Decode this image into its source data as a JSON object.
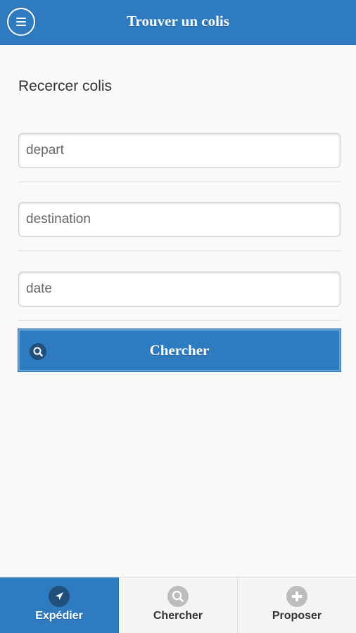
{
  "header": {
    "title": "Trouver un colis",
    "menu_icon": "menu-icon"
  },
  "main": {
    "section_label": "Recercer colis",
    "fields": {
      "depart_placeholder": "depart",
      "destination_placeholder": "destination",
      "date_placeholder": "date"
    },
    "search_button_label": "Chercher",
    "search_button_icon": "search-icon"
  },
  "navbar": {
    "items": [
      {
        "label": "Expédier",
        "icon": "send-icon",
        "active": true
      },
      {
        "label": "Chercher",
        "icon": "search-icon",
        "active": false
      },
      {
        "label": "Proposer",
        "icon": "plus-icon",
        "active": false
      }
    ]
  },
  "colors": {
    "accent": "#2f7bbf",
    "icon_dark": "#1f4f7a",
    "background": "#f9f9f9"
  }
}
